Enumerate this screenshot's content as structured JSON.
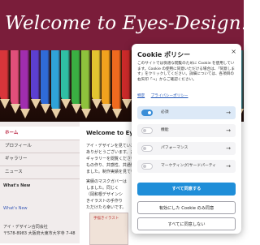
{
  "site": {
    "title": "Welcome to Eyes-Design.L.L.C.",
    "nav": [
      "ホーム",
      "プロフィール",
      "ギャラリー",
      "ニュース"
    ],
    "whats_new": "What's New",
    "side_link_1": "What's New",
    "side_company": "アイ・デザイン合同会社",
    "side_address": "〒578-8983 大阪府大東市大字寺 7-48",
    "main_title": "Welcome to Eyes-",
    "main_para_1": [
      "アイ・デザインを見ていただき",
      "ありがとうございます。お気に",
      "ギャラリーを閲覧ください。",
      "もの作り、共感性、共通性の",
      "ました。制作実績を見ていた"
    ],
    "main_para_2": [
      "実績のマスクガバーは",
      "しました。同じく",
      "（岡和根デザインシ",
      "きイラストの手作り",
      "ただけたら幸いです。"
    ],
    "thumb_label": "手描きイラスト"
  },
  "cookie": {
    "title": "Cookie ポリシー",
    "description": "このサイトでは快適な閲覧のために Cookie を使用しています。Cookie の使用に同意いただける場合は、「同意します」をクリックしてください。詳細については、各項目の右矢印「→」からご確認ください。",
    "links": [
      "特定",
      "プライバシーポリシー"
    ],
    "categories": [
      {
        "label": "必須",
        "enabled": true
      },
      {
        "label": "機能",
        "enabled": false
      },
      {
        "label": "パフォーマンス",
        "enabled": false
      },
      {
        "label": "マーケティング/サードパーティ",
        "enabled": false
      }
    ],
    "accept_all": "すべて同意する",
    "accept_necessary": "有効にした Cookie のみ同意",
    "reject_all": "すべてに同意しない",
    "close_glyph": "×",
    "arrow_glyph": "→"
  },
  "colors": {
    "header": "#7a1d3a",
    "accent": "#1f8ed8",
    "toggle_on": "#3a8ed8",
    "nav_active": "#b71c3a"
  },
  "banner_colors": [
    "#d8353a",
    "#e14f7a",
    "#a02dae",
    "#5c3fd0",
    "#2f6bd7",
    "#2fa3d9",
    "#2fbfa4",
    "#3aaf42",
    "#8ec23c",
    "#e2c430",
    "#f1a21e",
    "#ef6a1f",
    "#cc2a2a",
    "#8b1e3f",
    "#b48a5c",
    "#6b4226",
    "#333333",
    "#999999",
    "#e2e2e2",
    "#ffffff",
    "#d36fa2",
    "#7d5fc4",
    "#3a7bd5",
    "#46b7c6"
  ]
}
